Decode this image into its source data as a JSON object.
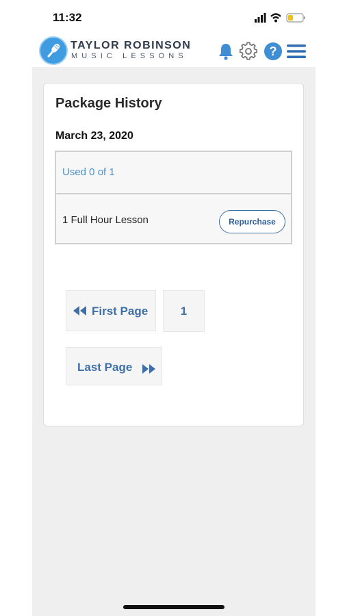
{
  "status_bar": {
    "time": "11:32"
  },
  "header": {
    "brand_line1": "TAYLOR ROBINSON",
    "brand_line2": "MUSIC LESSONS",
    "icons": [
      "microphone-logo-icon",
      "bell-icon",
      "gear-icon",
      "help-icon",
      "menu-icon"
    ]
  },
  "card": {
    "title": "Package History",
    "date": "March 23, 2020",
    "package": {
      "usage": "Used 0 of 1",
      "lesson": "1 Full Hour Lesson",
      "repurchase_label": "Repurchase"
    }
  },
  "pagination": {
    "first_label": "First Page",
    "page_number": "1",
    "last_label": "Last Page"
  },
  "colors": {
    "accent": "#3f9ce0",
    "link": "#4a90c8",
    "button_text": "#2c5f9b",
    "background": "#efefef"
  }
}
